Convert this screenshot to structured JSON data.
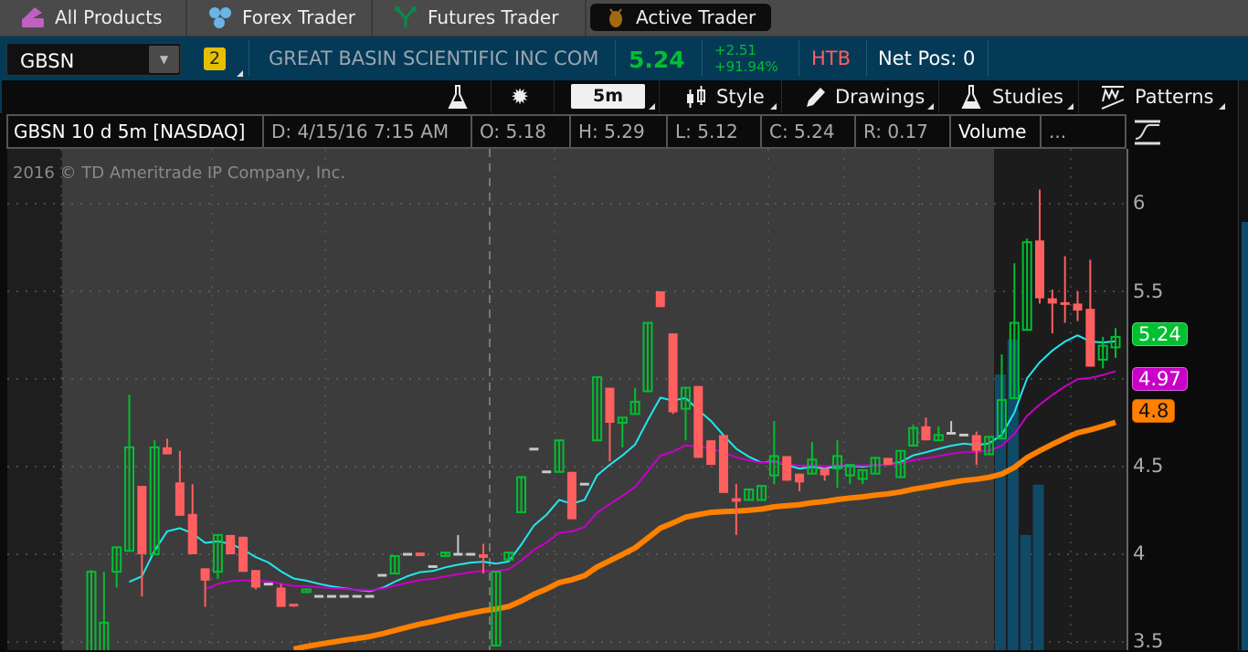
{
  "top_tabs": [
    {
      "label": "All Products",
      "icon": "all-products-icon",
      "color": "#c060c0"
    },
    {
      "label": "Forex Trader",
      "icon": "forex-icon",
      "color": "#6ab4e8"
    },
    {
      "label": "Futures Trader",
      "icon": "futures-icon",
      "color": "#0a8a4a"
    },
    {
      "label": "Active Trader",
      "icon": "active-trader-icon",
      "color": "#a06a10",
      "active": true
    }
  ],
  "quote": {
    "symbol": "GBSN",
    "link_badge": "2",
    "description": "GREAT BASIN SCIENTIFIC INC COM",
    "last": "5.24",
    "change": "+2.51",
    "change_pct": "+91.94%",
    "borrow_status": "HTB",
    "net_pos": "Net Pos: 0"
  },
  "toolbar": {
    "timeframe": "5m",
    "style": "Style",
    "drawings": "Drawings",
    "studies": "Studies",
    "patterns": "Patterns"
  },
  "info_bar": {
    "title": "GBSN 10 d 5m [NASDAQ]",
    "date": "D:  4/15/16 7:15 AM",
    "open": "O:  5.18",
    "high": "H:  5.29",
    "low": "L:  5.12",
    "close": "C:  5.24",
    "range": "R:  0.17",
    "volume": "Volume",
    "more": "..."
  },
  "watermark": "2016 © TD Ameritrade IP Company, Inc.",
  "chart_data": {
    "type": "candlestick",
    "ylim": [
      3.5,
      6.1
    ],
    "y_ticks": [
      "6",
      "5.5",
      "4.5",
      "4",
      "3.5"
    ],
    "grid": true,
    "colors": {
      "up": "#00c030",
      "down": "#ff5f5f",
      "doji": "#c8c8c8",
      "ma_fast": "#20e8f0",
      "ma_mid": "#c800c8",
      "ma_slow": "#ff8000",
      "volume": "#114a66"
    },
    "price_bubbles": [
      {
        "value": "5.24",
        "color": "#00c030"
      },
      {
        "value": "4.97",
        "color": "#c800c8"
      },
      {
        "value": "4.8",
        "color": "#ff8000"
      }
    ],
    "candles": [
      [
        3.4,
        3.91,
        3.35,
        3.9
      ],
      [
        3.35,
        3.9,
        3.3,
        3.61
      ],
      [
        3.9,
        4.04,
        3.81,
        4.04
      ],
      [
        4.02,
        4.91,
        4.02,
        4.61
      ],
      [
        4.39,
        4.39,
        3.76,
        4.0
      ],
      [
        4.0,
        4.65,
        4.0,
        4.61
      ],
      [
        4.61,
        4.66,
        4.57,
        4.57
      ],
      [
        4.41,
        4.59,
        4.22,
        4.22
      ],
      [
        4.23,
        4.4,
        4.0,
        4.0
      ],
      [
        3.92,
        3.92,
        3.7,
        3.85
      ],
      [
        3.9,
        4.11,
        3.86,
        4.11
      ],
      [
        4.11,
        4.11,
        4.0,
        4.0
      ],
      [
        4.1,
        4.1,
        3.9,
        3.9
      ],
      [
        3.91,
        3.91,
        3.8,
        3.81
      ],
      [
        3.83,
        3.83,
        3.83,
        3.83
      ],
      [
        3.81,
        3.83,
        3.7,
        3.7
      ],
      [
        3.71,
        3.71,
        3.7,
        3.7
      ],
      [
        3.79,
        3.8,
        3.79,
        3.8
      ],
      [
        3.76,
        3.76,
        3.76,
        3.76
      ],
      [
        3.76,
        3.76,
        3.76,
        3.76
      ],
      [
        3.76,
        3.76,
        3.76,
        3.76
      ],
      [
        3.76,
        3.76,
        3.76,
        3.76
      ],
      [
        3.76,
        3.76,
        3.76,
        3.76
      ],
      [
        3.88,
        3.88,
        3.88,
        3.88
      ],
      [
        3.89,
        3.99,
        3.89,
        3.99
      ],
      [
        4.0,
        4.0,
        4.0,
        4.0
      ],
      [
        4.01,
        4.01,
        3.99,
        3.99
      ],
      [
        3.93,
        3.93,
        3.93,
        3.93
      ],
      [
        3.99,
        4.01,
        3.99,
        4.01
      ],
      [
        4.0,
        4.11,
        4.0,
        4.0
      ],
      [
        4.0,
        4.0,
        4.0,
        4.0
      ],
      [
        4.0,
        4.06,
        3.89,
        3.98
      ],
      [
        3.48,
        3.9,
        3.48,
        3.9
      ],
      [
        3.97,
        4.01,
        3.97,
        4.01
      ],
      [
        4.24,
        4.44,
        4.24,
        4.44
      ],
      [
        4.6,
        4.6,
        4.6,
        4.6
      ],
      [
        4.47,
        4.47,
        4.47,
        4.47
      ],
      [
        4.47,
        4.65,
        4.47,
        4.65
      ],
      [
        4.47,
        4.47,
        4.2,
        4.2
      ],
      [
        4.4,
        4.4,
        4.4,
        4.4
      ],
      [
        4.65,
        5.01,
        4.65,
        5.01
      ],
      [
        4.95,
        4.95,
        4.53,
        4.75
      ],
      [
        4.75,
        4.78,
        4.61,
        4.78
      ],
      [
        4.8,
        4.95,
        4.8,
        4.87
      ],
      [
        4.93,
        5.32,
        4.93,
        5.32
      ],
      [
        5.5,
        5.5,
        5.41,
        5.41
      ],
      [
        5.26,
        5.26,
        4.8,
        4.81
      ],
      [
        4.83,
        4.95,
        4.65,
        4.95
      ],
      [
        4.96,
        4.96,
        4.55,
        4.55
      ],
      [
        4.65,
        4.65,
        4.51,
        4.51
      ],
      [
        4.68,
        4.68,
        4.35,
        4.35
      ],
      [
        4.32,
        4.4,
        4.11,
        4.3
      ],
      [
        4.31,
        4.37,
        4.31,
        4.37
      ],
      [
        4.31,
        4.39,
        4.31,
        4.39
      ],
      [
        4.45,
        4.76,
        4.4,
        4.56
      ],
      [
        4.56,
        4.56,
        4.42,
        4.42
      ],
      [
        4.46,
        4.46,
        4.36,
        4.41
      ],
      [
        4.46,
        4.64,
        4.46,
        4.54
      ],
      [
        4.49,
        4.49,
        4.42,
        4.45
      ],
      [
        4.49,
        4.65,
        4.38,
        4.56
      ],
      [
        4.45,
        4.51,
        4.4,
        4.51
      ],
      [
        4.43,
        4.48,
        4.4,
        4.48
      ],
      [
        4.46,
        4.55,
        4.46,
        4.55
      ],
      [
        4.55,
        4.55,
        4.51,
        4.51
      ],
      [
        4.44,
        4.59,
        4.44,
        4.59
      ],
      [
        4.62,
        4.74,
        4.62,
        4.72
      ],
      [
        4.73,
        4.78,
        4.65,
        4.65
      ],
      [
        4.65,
        4.73,
        4.65,
        4.68
      ],
      [
        4.69,
        4.76,
        4.69,
        4.69
      ],
      [
        4.68,
        4.68,
        4.68,
        4.68
      ],
      [
        4.68,
        4.7,
        4.51,
        4.59
      ],
      [
        4.57,
        4.67,
        4.57,
        4.67
      ],
      [
        4.66,
        5.14,
        4.66,
        4.88
      ],
      [
        4.89,
        5.66,
        4.89,
        5.32
      ],
      [
        5.28,
        5.8,
        5.28,
        5.78
      ],
      [
        5.79,
        6.08,
        5.43,
        5.46
      ],
      [
        5.46,
        5.51,
        5.26,
        5.43
      ],
      [
        5.43,
        5.7,
        5.32,
        5.42
      ],
      [
        5.43,
        5.5,
        5.33,
        5.39
      ],
      [
        5.4,
        5.68,
        5.07,
        5.07
      ],
      [
        5.11,
        5.24,
        5.06,
        5.19
      ],
      [
        5.18,
        5.29,
        5.12,
        5.24
      ]
    ],
    "volume_relative": [
      0.55,
      0.62,
      0.23,
      0.33
    ]
  }
}
